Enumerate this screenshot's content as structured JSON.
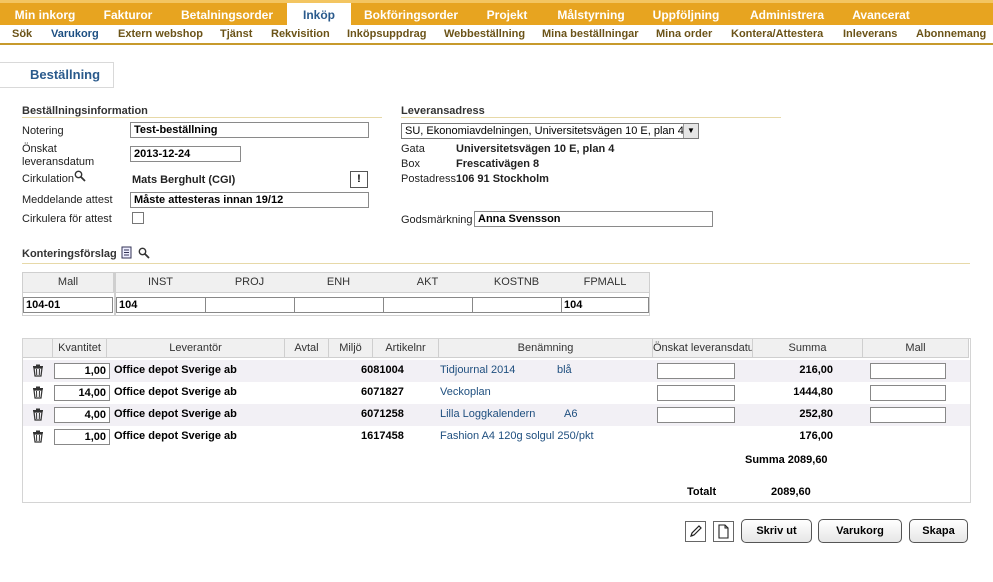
{
  "top_nav": [
    "Min inkorg",
    "Fakturor",
    "Betalningsorder",
    "Inköp",
    "Bokföringsorder",
    "Projekt",
    "Målstyrning",
    "Uppföljning",
    "Administrera",
    "Avancerat"
  ],
  "sub_nav": [
    "Sök",
    "Varukorg",
    "Extern webshop",
    "Tjänst",
    "Rekvisition",
    "Inköpsuppdrag",
    "Webbeställning",
    "Mina beställningar",
    "Mina order",
    "Kontera/Attestera",
    "Inleverans",
    "Abonnemang"
  ],
  "page_title": "Beställning",
  "order_info": {
    "section_title": "Beställningsinformation",
    "note_label": "Notering",
    "note_value": "Test-beställning",
    "date_label_1": "Önskat",
    "date_label_2": "leveransdatum",
    "date_value": "2013-12-24",
    "circulation_label": "Cirkulation",
    "circulation_value": "Mats Berghult (CGI)",
    "message_label": "Meddelande attest",
    "message_value": "Måste attesteras innan 19/12",
    "circulate_label": "Cirkulera för attest"
  },
  "delivery": {
    "section_title": "Leveransadress",
    "address_select": "SU, Ekonomiavdelningen, Universitetsvägen 10 E, plan 4",
    "street_label": "Gata",
    "street_value": "Universitetsvägen 10 E, plan 4",
    "box_label": "Box",
    "box_value": "Frescativägen 8",
    "postal_label": "Postadress",
    "postal_value": "106 91 Stockholm",
    "goods_label": "Godsmärkning",
    "goods_value": "Anna Svensson"
  },
  "coding": {
    "section_title": "Konteringsförslag",
    "mall_header": "Mall",
    "mall_value": "104-01",
    "headers": [
      "INST",
      "PROJ",
      "ENH",
      "AKT",
      "KOSTNB",
      "FPMALL"
    ],
    "values": [
      "104",
      "",
      "",
      "",
      "",
      "104"
    ]
  },
  "items_table": {
    "headers": [
      "Kvantitet",
      "Leverantör",
      "Avtal",
      "Miljö",
      "Artikelnr",
      "Benämning",
      "Önskat leveransdatu...",
      "Summa",
      "Mall"
    ],
    "rows": [
      {
        "qty": "1,00",
        "supplier": "Office depot Sverige ab",
        "article": "6081004",
        "name": "Tidjournal 2014",
        "extra": "blå",
        "sum": "216,00"
      },
      {
        "qty": "14,00",
        "supplier": "Office depot Sverige ab",
        "article": "6071827",
        "name": "Veckoplan",
        "extra": "",
        "sum": "1444,80"
      },
      {
        "qty": "4,00",
        "supplier": "Office depot Sverige ab",
        "article": "6071258",
        "name": "Lilla Loggkalendern",
        "extra": "A6",
        "sum": "252,80"
      },
      {
        "qty": "1,00",
        "supplier": "Office depot Sverige ab",
        "article": "1617458",
        "name": "Fashion A4 120g solgul 250/pkt",
        "extra": "",
        "sum": "176,00"
      }
    ],
    "sum_label": "Summa 2089,60",
    "total_label": "Totalt",
    "total_value": "2089,60"
  },
  "buttons": {
    "print": "Skriv ut",
    "cart": "Varukorg",
    "create": "Skapa"
  },
  "icons": {
    "search": "magnifier-icon",
    "trash": "trash-icon",
    "edit": "pencil-icon",
    "document": "document-icon"
  },
  "colors": {
    "nav_bg": "#e7a420",
    "accent_blue": "#2a5a8c",
    "subnav_text": "#6b5318"
  }
}
